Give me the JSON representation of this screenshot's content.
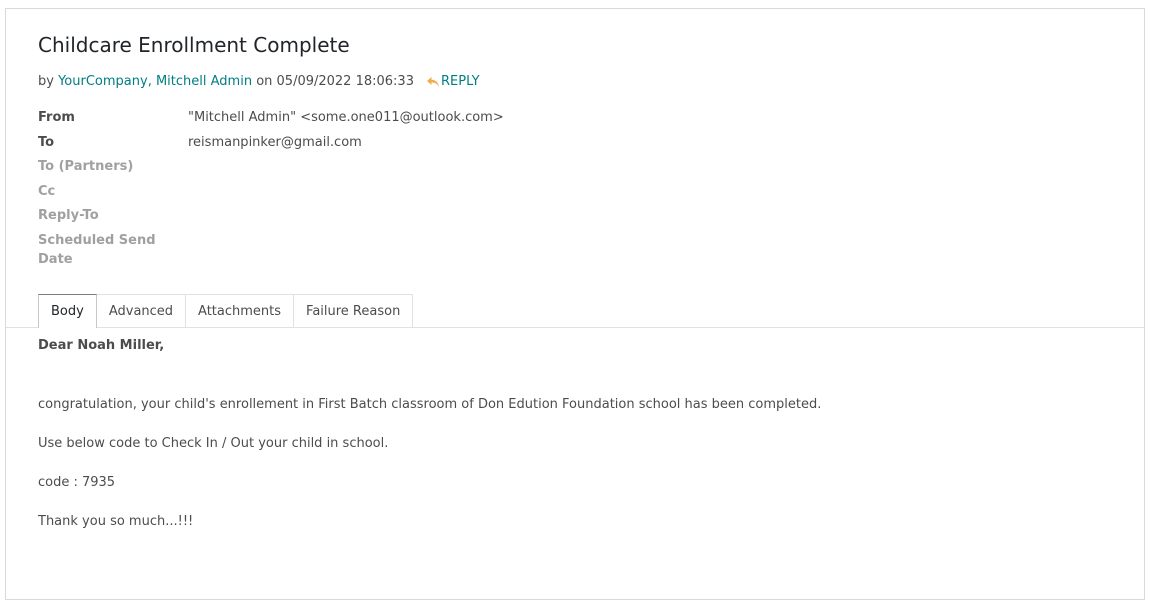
{
  "message": {
    "subject": "Childcare Enrollment Complete",
    "byline": {
      "prefix": "by",
      "author_company": "YourCompany, Mitchell Admin",
      "on_text": "on 05/09/2022 18:06:33",
      "reply_label": "REPLY"
    },
    "fields": [
      {
        "label": "From",
        "value": "\"Mitchell Admin\" <some.one011@outlook.com>"
      },
      {
        "label": "To",
        "value": "reismanpinker@gmail.com"
      },
      {
        "label": "To (Partners)",
        "value": ""
      },
      {
        "label": "Cc",
        "value": ""
      },
      {
        "label": "Reply-To",
        "value": ""
      },
      {
        "label": "Scheduled Send Date",
        "value": ""
      }
    ]
  },
  "tabs": [
    "Body",
    "Advanced",
    "Attachments",
    "Failure Reason"
  ],
  "active_tab": "Body",
  "body": {
    "greeting": "Dear Noah Miller,",
    "line1": "congratulation, your child's enrollement in First Batch classroom of Don Edution Foundation school has been completed.",
    "line2": "Use below code to Check In / Out your child in school.",
    "line3": "code : 7935",
    "line4": "Thank you so much...!!!"
  },
  "colors": {
    "link": "#017e84",
    "reply_icon": "#f0ad4e"
  }
}
